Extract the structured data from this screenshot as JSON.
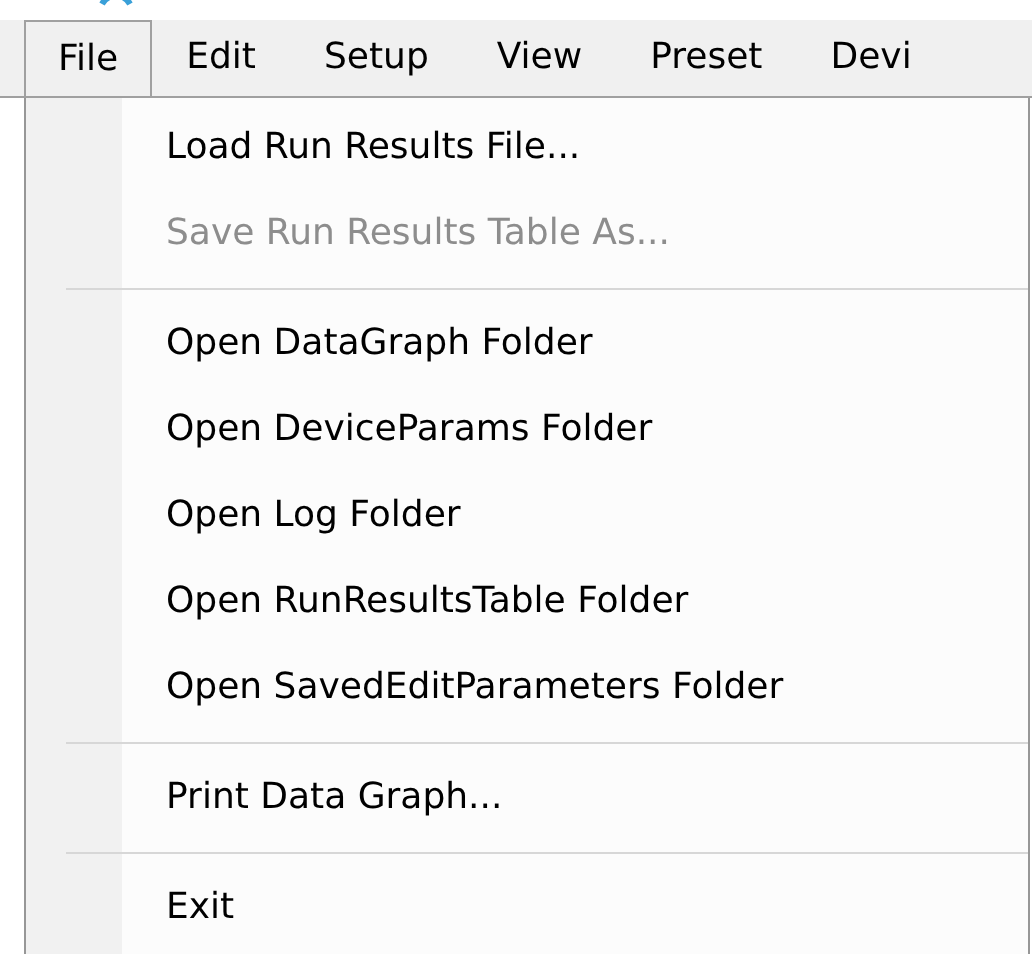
{
  "menu_bar": [
    {
      "label": "File",
      "selected": true
    },
    {
      "label": "Edit",
      "selected": false
    },
    {
      "label": "Setup",
      "selected": false
    },
    {
      "label": "View",
      "selected": false
    },
    {
      "label": "Preset",
      "selected": false
    },
    {
      "label": "Devi",
      "selected": false
    }
  ],
  "file_menu": [
    {
      "kind": "item",
      "label": "Load Run Results File...",
      "disabled": false
    },
    {
      "kind": "item",
      "label": "Save Run Results Table As...",
      "disabled": true
    },
    {
      "kind": "separator"
    },
    {
      "kind": "item",
      "label": "Open DataGraph Folder",
      "disabled": false
    },
    {
      "kind": "item",
      "label": "Open DeviceParams Folder",
      "disabled": false
    },
    {
      "kind": "item",
      "label": "Open Log Folder",
      "disabled": false
    },
    {
      "kind": "item",
      "label": "Open RunResultsTable Folder",
      "disabled": false
    },
    {
      "kind": "item",
      "label": "Open SavedEditParameters Folder",
      "disabled": false
    },
    {
      "kind": "separator"
    },
    {
      "kind": "item",
      "label": "Print Data Graph...",
      "disabled": false
    },
    {
      "kind": "separator"
    },
    {
      "kind": "item",
      "label": "Exit",
      "disabled": false
    }
  ]
}
